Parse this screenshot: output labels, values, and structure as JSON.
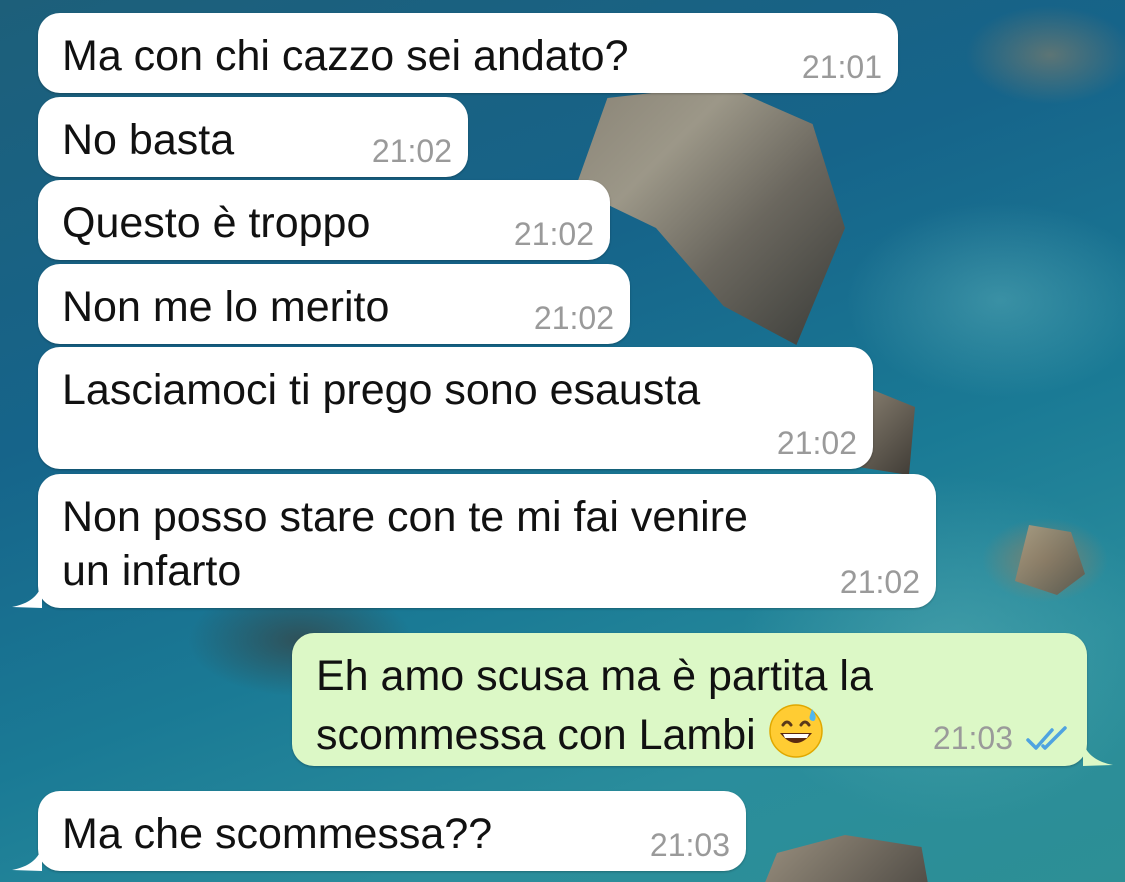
{
  "messages": [
    {
      "direction": "in",
      "text": "Ma con chi cazzo sei andato?",
      "time": "21:01"
    },
    {
      "direction": "in",
      "text": "No basta",
      "time": "21:02"
    },
    {
      "direction": "in",
      "text": "Questo è troppo",
      "time": "21:02"
    },
    {
      "direction": "in",
      "text": "Non me lo merito",
      "time": "21:02"
    },
    {
      "direction": "in",
      "text": "Lasciamoci ti prego sono esausta",
      "time": "21:02"
    },
    {
      "direction": "in",
      "text": "Non posso stare con te mi fai venire\nun infarto",
      "time": "21:02"
    },
    {
      "direction": "out",
      "text": "Eh amo scusa ma è partita la\nscommessa con Lambi",
      "emoji": "grinning-face-with-sweat",
      "time": "21:03",
      "status": "read"
    },
    {
      "direction": "in",
      "text": "Ma che scommessa??",
      "time": "21:03"
    }
  ],
  "colors": {
    "incoming_bubble": "#ffffff",
    "outgoing_bubble": "#dcf8c6",
    "timestamp": "#9a9a9a",
    "read_ticks": "#4fa3e0"
  }
}
